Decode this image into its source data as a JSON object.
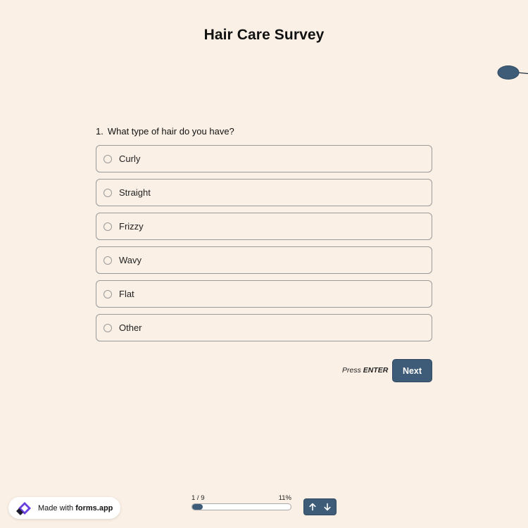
{
  "survey": {
    "title": "Hair Care Survey"
  },
  "question": {
    "number": "1.",
    "text": "What type of hair do you have?",
    "options": [
      {
        "label": "Curly"
      },
      {
        "label": "Straight"
      },
      {
        "label": "Frizzy"
      },
      {
        "label": "Wavy"
      },
      {
        "label": "Flat"
      },
      {
        "label": "Other"
      }
    ]
  },
  "actions": {
    "press_prefix": "Press",
    "press_key": "ENTER",
    "next_label": "Next"
  },
  "footer": {
    "made_with_prefix": "Made with",
    "brand": "forms.app",
    "progress_count": "1 / 9",
    "progress_percent": "11%",
    "progress_fraction": 0.11
  },
  "colors": {
    "background": "#FAF0E6",
    "accent": "#3E5C77",
    "border": "#9A9A9A"
  },
  "icons": {
    "up": "arrow-up-icon",
    "down": "arrow-down-icon",
    "logo": "forms-app-logo-icon"
  }
}
